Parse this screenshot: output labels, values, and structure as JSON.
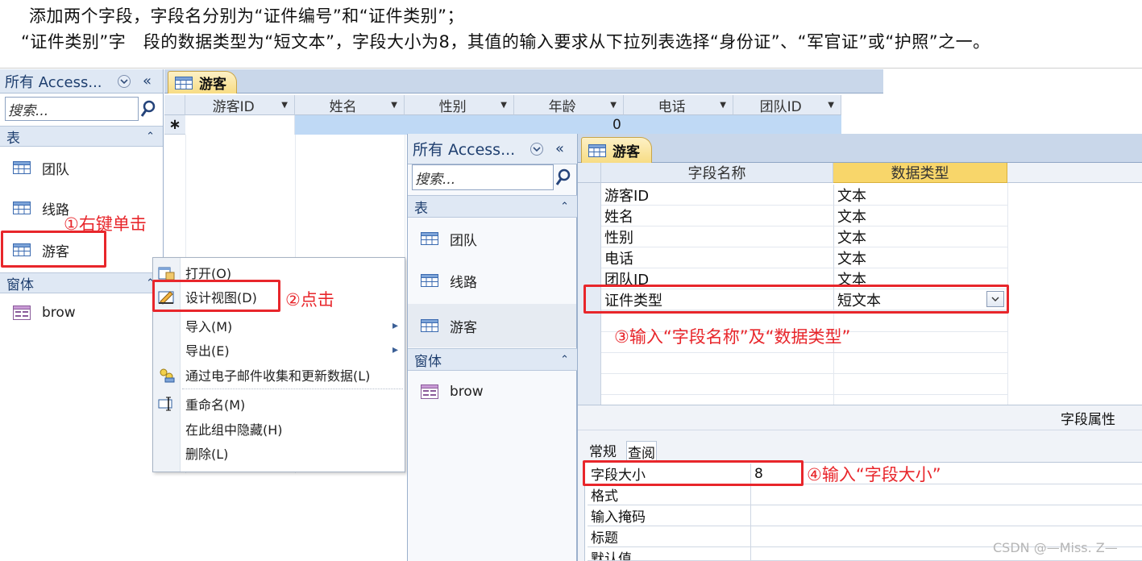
{
  "instructions": {
    "line1": "添加两个字段，字段名分别为“证件编号”和“证件类别”；",
    "line2": "“证件类别”字　段的数据类型为“短文本”，字段大小为8，其值的输入要求从下拉列表选择“身份证”、“军官证”或“护照”之一。"
  },
  "nav_left": {
    "header": "所有 Access...",
    "search_placeholder": "搜索...",
    "group_tables": "表",
    "tables": [
      "团队",
      "线路",
      "游客"
    ],
    "group_forms": "窗体",
    "forms": [
      "brow"
    ]
  },
  "datasheet": {
    "tab_label": "游客",
    "columns": [
      "游客ID",
      "姓名",
      "性别",
      "年龄",
      "电话",
      "团队ID"
    ],
    "new_row_marker": "∗",
    "new_row_age_default": "0"
  },
  "context_menu": {
    "items": [
      {
        "label": "打开(O)",
        "icon": "open-icon"
      },
      {
        "label": "设计视图(D)",
        "icon": "design-view-icon"
      },
      {
        "label": "导入(M)",
        "icon": "",
        "submenu": "▸"
      },
      {
        "label": "导出(E)",
        "icon": "",
        "submenu": "▸"
      },
      {
        "label": "通过电子邮件收集和更新数据(L)",
        "icon": "email-collect-icon"
      },
      {
        "label": "重命名(M)",
        "icon": "rename-icon"
      },
      {
        "label": "在此组中隐藏(H)",
        "icon": ""
      },
      {
        "label": "删除(L)",
        "icon": ""
      }
    ]
  },
  "nav_right": {
    "header": "所有 Access...",
    "search_placeholder": "搜索...",
    "group_tables": "表",
    "tables": [
      "团队",
      "线路",
      "游客"
    ],
    "group_forms": "窗体",
    "forms": [
      "brow"
    ]
  },
  "design": {
    "tab_label": "游客",
    "col_field_name": "字段名称",
    "col_data_type": "数据类型",
    "rows": [
      {
        "name": "游客ID",
        "type": "文本"
      },
      {
        "name": "姓名",
        "type": "文本"
      },
      {
        "name": "性别",
        "type": "文本"
      },
      {
        "name": "电话",
        "type": "文本"
      },
      {
        "name": "团队ID",
        "type": "文本"
      },
      {
        "name": "证件类型",
        "type": "短文本"
      }
    ],
    "field_props_label": "字段属性",
    "prop_tabs": [
      "常规",
      "查阅"
    ],
    "props": [
      {
        "name": "字段大小",
        "value": "8"
      },
      {
        "name": "格式",
        "value": ""
      },
      {
        "name": "输入掩码",
        "value": ""
      },
      {
        "name": "标题",
        "value": ""
      },
      {
        "name": "默认值",
        "value": ""
      }
    ]
  },
  "annotations": {
    "step1": "①右键单击",
    "step2": "②点击",
    "step3": "③输入“字段名称”及“数据类型”",
    "step4": "④输入“字段大小”"
  },
  "watermark": "CSDN @—Miss. Z—",
  "colors": {
    "annotation_red": "#e8262b",
    "selected_header": "#f8d66a",
    "new_row_highlight": "#bfd9f5"
  }
}
